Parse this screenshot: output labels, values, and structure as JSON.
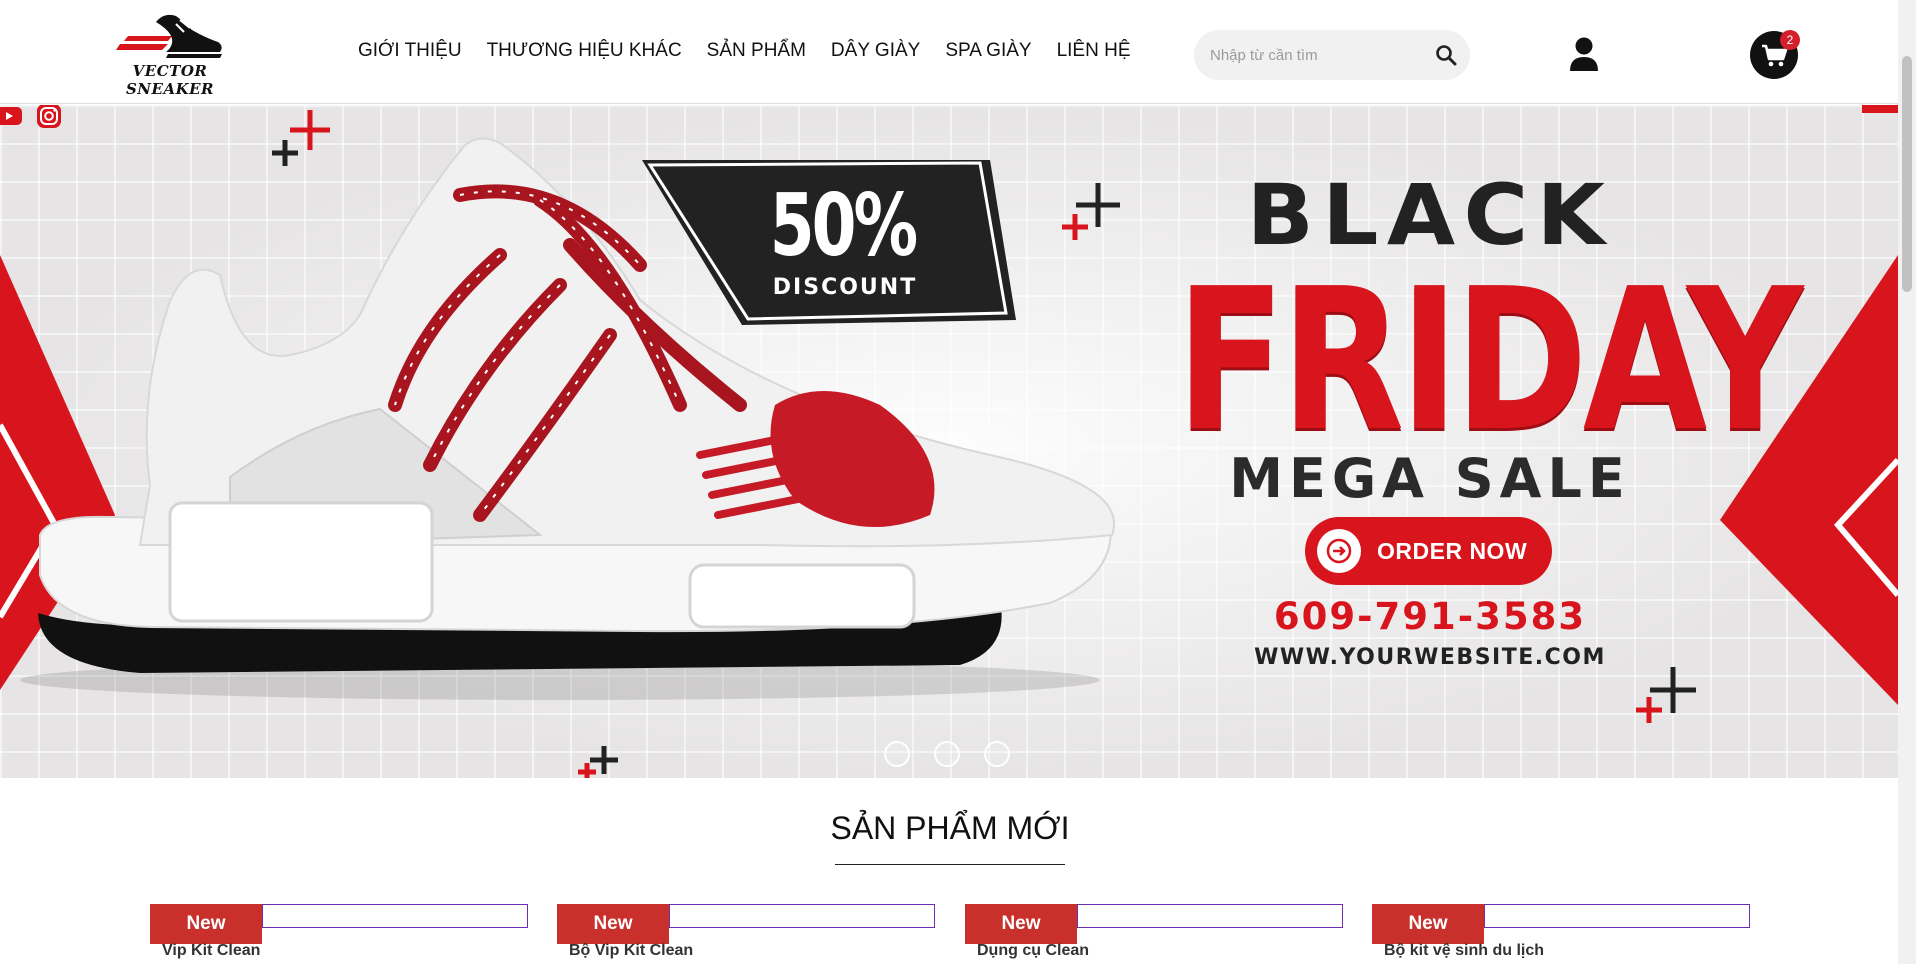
{
  "logo": {
    "text": "VECTOR SNEAKER",
    "icon": "sneaker-logo-icon"
  },
  "nav": {
    "items": [
      {
        "label": "GIỚI THIỆU"
      },
      {
        "label": "THƯƠNG HIỆU KHÁC"
      },
      {
        "label": "SẢN PHẨM"
      },
      {
        "label": "DÂY GIÀY"
      },
      {
        "label": "SPA GIÀY"
      },
      {
        "label": "LIÊN HỆ"
      }
    ]
  },
  "search": {
    "placeholder": "Nhập từ cần tìm",
    "value": "",
    "icon": "search-icon"
  },
  "account": {
    "icon": "user-icon"
  },
  "cart": {
    "icon": "cart-icon",
    "count": "2"
  },
  "banner": {
    "discount_value": "50%",
    "discount_label": "DISCOUNT",
    "headline_1": "BLACK",
    "headline_2": "FRIDAY",
    "headline_3": "MEGA SALE",
    "cta": "ORDER NOW",
    "phone": "609-791-3583",
    "website": "WWW.YOURWEBSITE.COM",
    "slides_total": 3,
    "colors": {
      "accent_red": "#d8141c",
      "dark": "#222222",
      "background": "#e6e4e5"
    }
  },
  "section": {
    "title": "SẢN PHẨM MỚI"
  },
  "products": [
    {
      "badge": "New",
      "name": "Vip Kit Clean"
    },
    {
      "badge": "New",
      "name": "Bộ Vip Kit Clean"
    },
    {
      "badge": "New",
      "name": "Dụng cụ Clean"
    },
    {
      "badge": "New",
      "name": "Bộ kit vệ sinh du lịch"
    }
  ]
}
